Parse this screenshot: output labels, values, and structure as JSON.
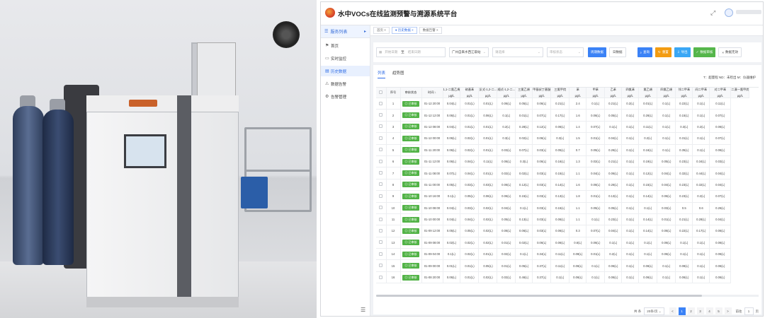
{
  "app": {
    "title": "水中VOCs在线监测预警与溯源系统平台",
    "user_name": "用户"
  },
  "sidebar": {
    "header": "服务列表",
    "items": [
      {
        "label": "首页",
        "icon": "flag-icon"
      },
      {
        "label": "实时监控",
        "icon": "monitor-icon"
      },
      {
        "label": "历史数据",
        "icon": "data-icon",
        "active": true
      },
      {
        "label": "数据告警",
        "icon": "alert-icon"
      },
      {
        "label": "告警管理",
        "icon": "settings-icon"
      }
    ]
  },
  "breadcrumb": [
    {
      "label": "首页 ×"
    },
    {
      "label": "● 历史数据 ×",
      "active": true
    },
    {
      "label": "数据告警 ×"
    }
  ],
  "filter": {
    "start_placeholder": "开始日期",
    "range_sep": "至",
    "end_placeholder": "结束日期",
    "station_value": "广州自来水西江取站",
    "select2_placeholder": "请选择",
    "select3_placeholder": "审核状态",
    "btn_query_primary": "周期数据",
    "btn_realtime": "日数据",
    "btn_search": "查询",
    "btn_reset": "重置",
    "btn_export": "导出",
    "btn_audit": "数据审核",
    "btn_more": "数据无效"
  },
  "tabs": [
    {
      "label": "列表",
      "active": true
    },
    {
      "label": "趋势图"
    }
  ],
  "legend": "T：超量程   ND：未检出   M：仪器维护",
  "table": {
    "headers": [
      {
        "name": "序号",
        "unit": ""
      },
      {
        "name": "审核状态",
        "unit": ""
      },
      {
        "name": "时间 ↓",
        "unit": ""
      },
      {
        "name": "1,1-二氯乙烯",
        "unit": "μg/L"
      },
      {
        "name": "硝基苯",
        "unit": "μg/L"
      },
      {
        "name": "反式-1,2-二...",
        "unit": "μg/L"
      },
      {
        "name": "顺式-1,2-二...",
        "unit": "μg/L"
      },
      {
        "name": "三氯乙烯",
        "unit": "μg/L"
      },
      {
        "name": "甲基叔丁基醚",
        "unit": "μg/L"
      },
      {
        "name": "三氯甲烷",
        "unit": "μg/L"
      },
      {
        "name": "苯",
        "unit": "μg/L"
      },
      {
        "name": "甲苯",
        "unit": "μg/L"
      },
      {
        "name": "乙苯",
        "unit": "μg/L"
      },
      {
        "name": "四氯苯",
        "unit": "μg/L"
      },
      {
        "name": "氯乙烯",
        "unit": "μg/L"
      },
      {
        "name": "四氯乙烯",
        "unit": "μg/L"
      },
      {
        "name": "邻二甲苯",
        "unit": "μg/L"
      },
      {
        "name": "间二甲苯",
        "unit": "μg/L"
      },
      {
        "name": "对二甲苯",
        "unit": "μg/L"
      },
      {
        "name": "二溴一氯甲烷",
        "unit": "μg/L"
      }
    ],
    "rows": [
      [
        "1",
        "已审核",
        "01-12 20:00",
        "0.04(L)",
        "0.01(L)",
        "0.01(L)",
        "0.06(L)",
        "0.05(L)",
        "0.06(L)",
        "0.21(L)",
        "2.4",
        "0.1(L)",
        "0.21(L)",
        "0.2(L)",
        "0.01(L)",
        "0.1(L)",
        "0.22(L)",
        "0.1(L)",
        "0.11(L)"
      ],
      [
        "2",
        "已审核",
        "01-12 12:00",
        "0.06(L)",
        "0.01(L)",
        "0.06(L)",
        "0.1(L)",
        "0.01(L)",
        "0.07(L)",
        "0.17(L)",
        "1.6",
        "0.06(L)",
        "0.05(L)",
        "0.1(L)",
        "0.26(L)",
        "0.1(L)",
        "0.15(L)",
        "0.1(L)",
        "0.07(L)"
      ],
      [
        "3",
        "已审核",
        "01-12 08:00",
        "0.04(L)",
        "0.01(L)",
        "0.01(L)",
        "0.2(L)",
        "0.28(L)",
        "0.12(L)",
        "0.06(L)",
        "1.4",
        "0.07(L)",
        "0.1(L)",
        "0.1(L)",
        "0.11(L)",
        "0.1(L)",
        "0.3(L)",
        "0.2(L)",
        "0.06(L)"
      ],
      [
        "4",
        "已审核",
        "01-12 00:00",
        "0.06(L)",
        "0.02(L)",
        "0.01(L)",
        "0.3(L)",
        "0.02(L)",
        "0.06(L)",
        "0.3(L)",
        "1.5",
        "0.01(L)",
        "0.04(L)",
        "0.1(L)",
        "0.2(L)",
        "0.1(L)",
        "0.31(L)",
        "0.1(L)",
        "0.07(L)"
      ],
      [
        "5",
        "已审核",
        "01-11 20:00",
        "0.06(L)",
        "0.02(L)",
        "0.01(L)",
        "0.03(L)",
        "0.07(L)",
        "0.03(L)",
        "0.05(L)",
        "0.7",
        "0.05(L)",
        "0.26(L)",
        "0.1(L)",
        "0.16(L)",
        "0.1(L)",
        "0.35(L)",
        "0.1(L)",
        "0.06(L)"
      ],
      [
        "6",
        "已审核",
        "01-11 12:00",
        "0.06(L)",
        "0.04(L)",
        "0.11(L)",
        "0.06(L)",
        "0.3(L)",
        "0.06(L)",
        "0.16(L)",
        "1.3",
        "0.02(L)",
        "0.21(L)",
        "0.1(L)",
        "0.19(L)",
        "0.05(L)",
        "0.23(L)",
        "0.34(L)",
        "0.03(L)"
      ],
      [
        "7",
        "已审核",
        "01-11 08:00",
        "0.07(L)",
        "0.04(L)",
        "0.01(L)",
        "0.02(L)",
        "0.02(L)",
        "0.03(L)",
        "0.15(L)",
        "1.1",
        "0.04(L)",
        "0.06(L)",
        "0.1(L)",
        "0.12(L)",
        "0.04(L)",
        "0.32(L)",
        "0.44(L)",
        "0.04(L)"
      ],
      [
        "8",
        "已审核",
        "01-11 00:00",
        "0.05(L)",
        "0.03(L)",
        "0.03(L)",
        "0.06(L)",
        "0.12(L)",
        "0.03(L)",
        "0.14(L)",
        "1.6",
        "0.06(L)",
        "0.26(L)",
        "0.1(L)",
        "0.15(L)",
        "0.04(L)",
        "0.23(L)",
        "0.32(L)",
        "0.04(L)"
      ],
      [
        "9",
        "已审核",
        "01-10 16:00",
        "0.1(L)",
        "0.05(L)",
        "0.06(L)",
        "0.06(L)",
        "0.15(L)",
        "0.03(L)",
        "0.13(L)",
        "1.8",
        "0.01(L)",
        "0.13(L)",
        "0.1(L)",
        "0.14(L)",
        "0.06(L)",
        "0.23(L)",
        "0.2(L)",
        "0.07(L)"
      ],
      [
        "10",
        "已审核",
        "01-10 08:00",
        "0.04(L)",
        "0.03(L)",
        "0.02(L)",
        "0.04(L)",
        "0.1(L)",
        "0.03(L)",
        "0.15(L)",
        "1.1",
        "0.05(L)",
        "0.05(L)",
        "0.1(L)",
        "0.1(L)",
        "0.03(L)",
        "0.5",
        "0.6",
        "0.26(L)"
      ],
      [
        "11",
        "已审核",
        "01-10 00:00",
        "0.04(L)",
        "0.04(L)",
        "0.02(L)",
        "0.05(L)",
        "0.13(L)",
        "0.03(L)",
        "0.06(L)",
        "1.1",
        "0.1(L)",
        "0.23(L)",
        "0.1(L)",
        "0.14(L)",
        "0.01(L)",
        "0.21(L)",
        "0.28(L)",
        "0.04(L)"
      ],
      [
        "12",
        "已审核",
        "01-09 12:00",
        "0.05(L)",
        "0.05(L)",
        "0.02(L)",
        "0.06(L)",
        "0.06(L)",
        "0.03(L)",
        "0.06(L)",
        "0.3",
        "0.07(L)",
        "0.04(L)",
        "0.1(L)",
        "0.14(L)",
        "0.06(L)",
        "0.22(L)",
        "0.17(L)",
        "0.06(L)"
      ],
      [
        "13",
        "已审核",
        "01-09 08:00",
        "0.02(L)",
        "0.02(L)",
        "0.02(L)",
        "0.01(L)",
        "0.02(L)",
        "0.06(L)",
        "0.06(L)",
        "0.6(L)",
        "0.06(L)",
        "0.1(L)",
        "0.1(L)",
        "0.1(L)",
        "0.06(L)",
        "0.1(L)",
        "0.1(L)",
        "0.06(L)"
      ],
      [
        "14",
        "已审核",
        "01-09 04:00",
        "0.1(L)",
        "0.02(L)",
        "0.01(L)",
        "0.02(L)",
        "0.1(L)",
        "0.34(L)",
        "0.11(L)",
        "0.08(L)",
        "0.01(L)",
        "0.2(L)",
        "0.1(L)",
        "0.1(L)",
        "0.06(L)",
        "0.1(L)",
        "0.1(L)",
        "0.06(L)"
      ],
      [
        "15",
        "已审核",
        "01-09 00:00",
        "0.01(L)",
        "0.01(L)",
        "0.05(L)",
        "0.01(L)",
        "0.05(L)",
        "0.37(L)",
        "0.11(L)",
        "0.06(L)",
        "0.1(L)",
        "0.06(L)",
        "0.1(L)",
        "0.06(L)",
        "0.1(L)",
        "0.08(L)",
        "0.1(L)",
        "0.06(L)"
      ],
      [
        "16",
        "已审核",
        "01-08 20:00",
        "0.06(L)",
        "0.01(L)",
        "0.02(L)",
        "0.02(L)",
        "0.46(L)",
        "0.37(L)",
        "0.1(L)",
        "0.06(L)",
        "0.1(L)",
        "0.06(L)",
        "0.1(L)",
        "0.06(L)",
        "0.1(L)",
        "0.06(L)",
        "0.1(L)",
        "0.06(L)"
      ]
    ]
  },
  "pager": {
    "total": "共 条",
    "page_size": "20条/页",
    "prev": "<",
    "pages": [
      "1",
      "2",
      "3",
      "4",
      "5"
    ],
    "active_page": "1",
    "next": ">",
    "goto_label": "前往",
    "goto_value": "1",
    "goto_suffix": "页"
  }
}
